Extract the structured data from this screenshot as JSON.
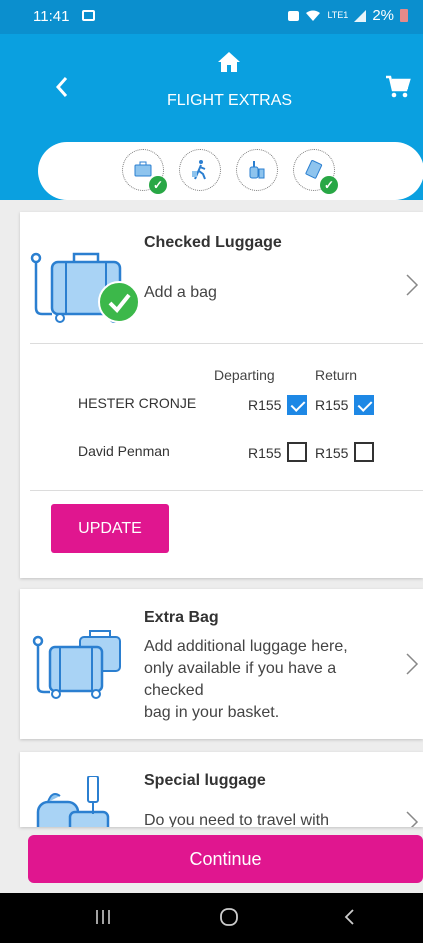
{
  "status_bar": {
    "time": "11:41",
    "battery": "2%",
    "network": "LTE1"
  },
  "header": {
    "title": "FLIGHT EXTRAS"
  },
  "steps": [
    {
      "name": "checked-luggage-step-icon",
      "done": true
    },
    {
      "name": "traveller-step-icon",
      "done": false
    },
    {
      "name": "special-luggage-step-icon",
      "done": false
    },
    {
      "name": "payment-step-icon",
      "done": true
    }
  ],
  "cards": {
    "checked_luggage": {
      "title": "Checked Luggage",
      "desc": "Add a bag"
    },
    "extra_bag": {
      "title": "Extra Bag",
      "desc_lines": [
        "Add additional luggage here,",
        "only available if you have a",
        "checked",
        "bag in your basket."
      ]
    },
    "special_luggage": {
      "title": "Special luggage",
      "desc": "Do you need to travel with"
    }
  },
  "passengers_table": {
    "col_departing": "Departing",
    "col_return": "Return",
    "rows": [
      {
        "name": "HESTER CRONJE",
        "departing_price": "R155",
        "departing_checked": true,
        "return_price": "R155",
        "return_checked": true
      },
      {
        "name": "David Penman",
        "departing_price": "R155",
        "departing_checked": false,
        "return_price": "R155",
        "return_checked": false
      }
    ]
  },
  "buttons": {
    "update": "UPDATE",
    "continue": "Continue"
  },
  "colors": {
    "brand_blue": "#0aa0e0",
    "brand_pink": "#e0168f",
    "success_green": "#28a745",
    "check_blue": "#1e88e5"
  }
}
